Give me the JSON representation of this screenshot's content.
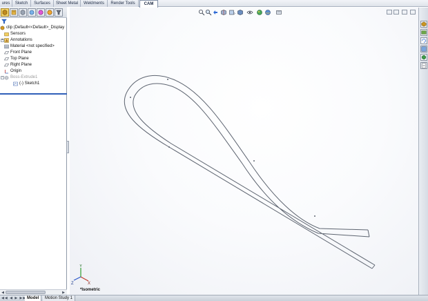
{
  "command_tabs": [
    "ures",
    "Sketch",
    "Surfaces",
    "Sheet Metal",
    "Weldments",
    "Render Tools",
    "CAM"
  ],
  "active_command_tab": "CAM",
  "feature_manager": {
    "toolbar_icons": [
      "feature-manager-icon",
      "property-manager-icon",
      "configuration-manager-icon",
      "dim-xpert-icon",
      "display-manager-icon",
      "cam-feature-icon",
      "cam-operation-icon"
    ],
    "filter_icon": "filter-icon",
    "tree": [
      {
        "label": "clip  (Default<<Default>_Display",
        "icon": "part-icon",
        "expander": "-",
        "muted": false
      },
      {
        "label": "Sensors",
        "icon": "sensors-folder-icon",
        "expander": "",
        "muted": false
      },
      {
        "label": "Annotations",
        "icon": "annotations-icon",
        "expander": "+",
        "muted": false
      },
      {
        "label": "Material <not specified>",
        "icon": "material-icon",
        "expander": "",
        "muted": false
      },
      {
        "label": "Front Plane",
        "icon": "plane-icon",
        "expander": "",
        "muted": false
      },
      {
        "label": "Top Plane",
        "icon": "plane-icon",
        "expander": "",
        "muted": false
      },
      {
        "label": "Right Plane",
        "icon": "plane-icon",
        "expander": "",
        "muted": false
      },
      {
        "label": "Origin",
        "icon": "origin-icon",
        "expander": "",
        "muted": false
      },
      {
        "label": "Boss-Extrude1",
        "icon": "extrude-icon",
        "expander": "-",
        "muted": true
      },
      {
        "label": "(-) Sketch1",
        "icon": "sketch-icon",
        "expander": "",
        "muted": false
      }
    ]
  },
  "bottom_tabs": [
    "Model",
    "Motion Study 1"
  ],
  "active_bottom_tab": "Model",
  "viewport": {
    "view_label": "*Isometric",
    "triad_labels": {
      "x": "X",
      "y": "Y",
      "z": "Z"
    },
    "heads_up_icons": [
      "zoom-to-fit-icon",
      "zoom-to-area-icon",
      "previous-view-icon",
      "section-view-icon",
      "view-orientation-icon",
      "display-style-icon",
      "hide-show-items-icon",
      "edit-appearance-icon",
      "apply-scene-icon",
      "view-settings-icon"
    ],
    "window_controls": [
      "restore-icon",
      "tile-icon",
      "maximize-icon",
      "close-icon"
    ]
  },
  "task_pane_icons": [
    "resources-icon",
    "design-library-icon",
    "file-explorer-icon",
    "view-palette-icon",
    "appearances-icon",
    "custom-properties-icon"
  ],
  "colors": {
    "accent": "#2f5fb8",
    "active_tab_bg": "#ffffff",
    "part_edge": "#5d6470"
  }
}
